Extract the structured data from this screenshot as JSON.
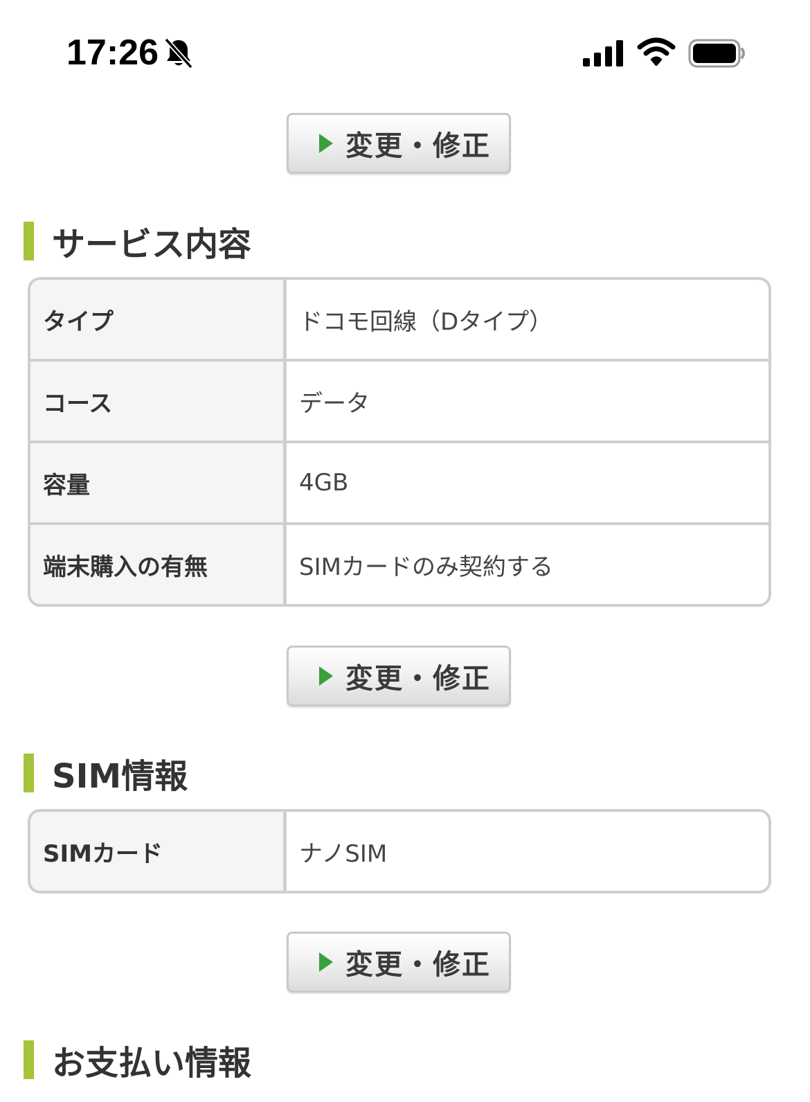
{
  "status_bar": {
    "time": "17:26"
  },
  "edit_button_label": "変更・修正",
  "sections": {
    "service": {
      "heading": "サービス内容",
      "rows": [
        {
          "label": "タイプ",
          "value": "ドコモ回線（Dタイプ）"
        },
        {
          "label": "コース",
          "value": "データ"
        },
        {
          "label": "容量",
          "value": "4GB"
        },
        {
          "label": "端末購入の有無",
          "value": "SIMカードのみ契約する"
        }
      ]
    },
    "sim": {
      "heading": "SIM情報",
      "rows": [
        {
          "label": "SIMカード",
          "value": "ナノSIM"
        }
      ]
    },
    "payment": {
      "heading": "お支払い情報"
    }
  },
  "colors": {
    "accent_bar": "#a5c43a",
    "button_arrow": "#3aa03a",
    "table_border": "#cfcfcf",
    "label_bg": "#f5f5f5"
  }
}
